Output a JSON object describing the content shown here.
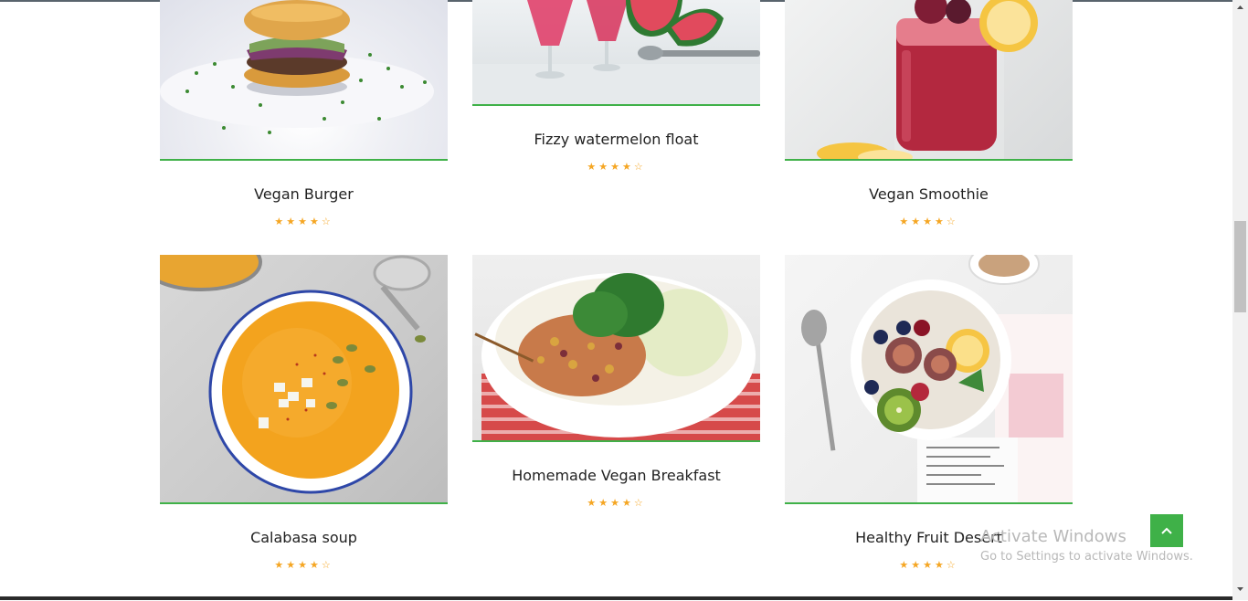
{
  "recipes": [
    {
      "title": "Vegan Burger",
      "rating": 4,
      "max": 5,
      "image": "vegan-burger-photo"
    },
    {
      "title": "Fizzy watermelon float",
      "rating": 4,
      "max": 5,
      "image": "watermelon-float-photo"
    },
    {
      "title": "Vegan Smoothie",
      "rating": 4,
      "max": 5,
      "image": "smoothie-jar-photo"
    },
    {
      "title": "Calabasa soup",
      "rating": 4,
      "max": 5,
      "image": "pumpkin-soup-photo"
    },
    {
      "title": "Homemade Vegan Breakfast",
      "rating": 4,
      "max": 5,
      "image": "salad-bowl-photo"
    },
    {
      "title": "Healthy Fruit Desert",
      "rating": 4,
      "max": 5,
      "image": "fruit-bowl-photo"
    }
  ],
  "stars": {
    "filled": "★",
    "empty": "☆"
  },
  "colors": {
    "accent": "#3fb148",
    "star": "#f5a623"
  },
  "back_to_top_icon": "chevron-up-icon",
  "watermark": {
    "line1": "Activate Windows",
    "line2": "Go to Settings to activate Windows."
  }
}
